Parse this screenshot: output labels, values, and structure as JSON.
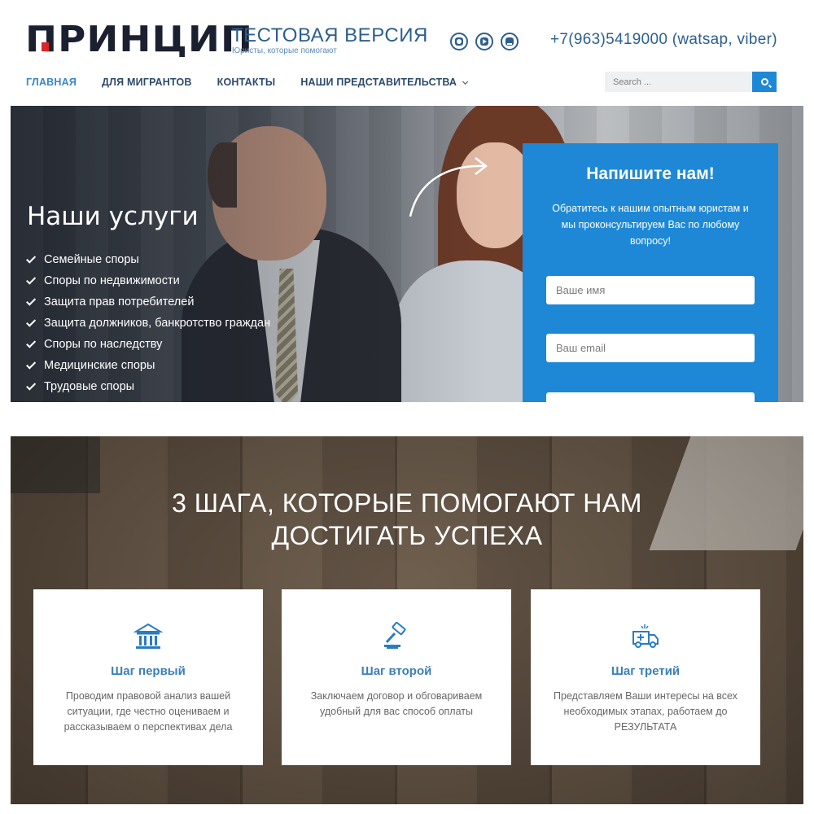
{
  "header": {
    "logo_text": "ПРИНЦИП",
    "site_title": "ТЕСТОВАЯ ВЕРСИЯ",
    "site_tagline": "Юристы, которые помогают",
    "phone": "+7(963)5419000 (watsap, viber)",
    "socials": [
      {
        "icon": "instagram-icon"
      },
      {
        "icon": "youtube-icon"
      },
      {
        "icon": "vk-icon"
      }
    ]
  },
  "nav": {
    "items": [
      {
        "label": "ГЛАВНАЯ",
        "active": true
      },
      {
        "label": "ДЛЯ МИГРАНТОВ"
      },
      {
        "label": "КОНТАКТЫ"
      },
      {
        "label": "НАШИ ПРЕДСТАВИТЕЛЬСТВА",
        "has_dropdown": true
      }
    ]
  },
  "search": {
    "placeholder": "Search ..."
  },
  "hero": {
    "title": "Наши услуги",
    "services": [
      "Семейные споры",
      "Споры по недвижимости",
      "Защита прав потребителей",
      "Защита должников, банкротство граждан",
      "Споры по наследству",
      "Медицинские споры",
      "Трудовые споры"
    ]
  },
  "contact_form": {
    "title": "Напишите нам!",
    "subtitle": "Обратитесь к нашим опытным юристам и мы проконсультируем Вас по любому вопросу!",
    "name_placeholder": "Ваше имя",
    "email_placeholder": "Ваш email"
  },
  "steps": {
    "title_line1": "3 ШАГА, КОТОРЫЕ ПОМОГАЮТ НАМ",
    "title_line2": "ДОСТИГАТЬ УСПЕХА",
    "items": [
      {
        "icon": "bank-icon",
        "title": "Шаг первый",
        "text": "Проводим правовой анализ вашей ситуации, где честно оцениваем и рассказываем о перспективах дела"
      },
      {
        "icon": "gavel-icon",
        "title": "Шаг второй",
        "text": "Заключаем договор и обговариваем удобный для вас способ оплаты"
      },
      {
        "icon": "ambulance-icon",
        "title": "Шаг третий",
        "text": "Представляем Ваши интересы на всех необходимых этапах, работаем до РЕЗУЛЬТАТА"
      }
    ]
  },
  "colors": {
    "brand_blue": "#1e88d6",
    "nav_text": "#2c4a6a",
    "logo_dark": "#1b2030",
    "logo_red": "#d9262c"
  }
}
